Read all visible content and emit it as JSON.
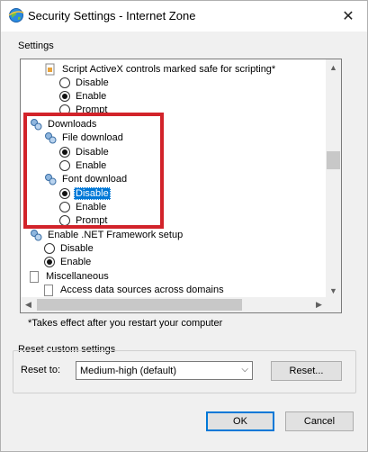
{
  "window": {
    "title": "Security Settings - Internet Zone",
    "close_glyph": "✕"
  },
  "settings": {
    "group_label": "Settings",
    "rows": [
      {
        "kind": "check-item",
        "text": "Script ActiveX controls marked safe for scripting*"
      },
      {
        "kind": "radio",
        "text": "Disable",
        "checked": false
      },
      {
        "kind": "radio",
        "text": "Enable",
        "checked": true
      },
      {
        "kind": "radio",
        "text": "Prompt",
        "checked": false
      },
      {
        "kind": "category",
        "text": "Downloads"
      },
      {
        "kind": "subcategory",
        "text": "File download"
      },
      {
        "kind": "radio",
        "text": "Disable",
        "checked": true
      },
      {
        "kind": "radio",
        "text": "Enable",
        "checked": false
      },
      {
        "kind": "subcategory",
        "text": "Font download"
      },
      {
        "kind": "radio",
        "text": "Disable",
        "checked": true,
        "selected": true
      },
      {
        "kind": "radio",
        "text": "Enable",
        "checked": false
      },
      {
        "kind": "radio",
        "text": "Prompt",
        "checked": false
      },
      {
        "kind": "subcategory",
        "text": "Enable .NET Framework setup"
      },
      {
        "kind": "radio",
        "text": "Disable",
        "checked": false
      },
      {
        "kind": "radio",
        "text": "Enable",
        "checked": true
      },
      {
        "kind": "category-page",
        "text": "Miscellaneous"
      },
      {
        "kind": "check-item",
        "text": "Access data sources across domains"
      }
    ],
    "note": "*Takes effect after you restart your computer"
  },
  "reset": {
    "group_label": "Reset custom settings",
    "reset_to_label": "Reset to:",
    "selected_level": "Medium-high (default)",
    "reset_button": "Reset..."
  },
  "footer": {
    "ok_label": "OK",
    "cancel_label": "Cancel"
  },
  "colors": {
    "highlight_border": "#d2232a",
    "selection": "#0078d7"
  }
}
